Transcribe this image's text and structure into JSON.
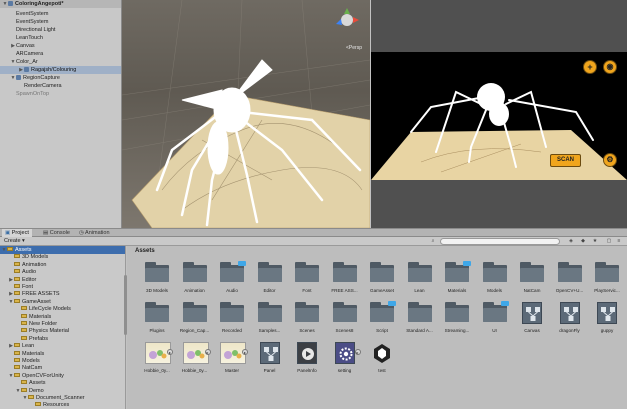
{
  "hierarchy": {
    "rows": [
      {
        "label": "ColoringAngepoti*",
        "indent": 0,
        "arrow": "▼",
        "icon": true,
        "style": "title"
      },
      {
        "label": "EventSystem",
        "indent": 1,
        "arrow": "",
        "icon": false,
        "style": "normal"
      },
      {
        "label": "EventSystem",
        "indent": 1,
        "arrow": "",
        "icon": false,
        "style": "normal"
      },
      {
        "label": "Directional Light",
        "indent": 1,
        "arrow": "",
        "icon": false,
        "style": "normal"
      },
      {
        "label": "LeanTouch",
        "indent": 1,
        "arrow": "",
        "icon": false,
        "style": "normal"
      },
      {
        "label": "Canvas",
        "indent": 1,
        "arrow": "▶",
        "icon": false,
        "style": "normal"
      },
      {
        "label": "ARCamera",
        "indent": 1,
        "arrow": "",
        "icon": false,
        "style": "normal"
      },
      {
        "label": "Color_Ar",
        "indent": 1,
        "arrow": "▼",
        "icon": false,
        "style": "normal"
      },
      {
        "label": "Ragajsh/Colouring",
        "indent": 2,
        "arrow": "▶",
        "icon": true,
        "style": "selected"
      },
      {
        "label": "RegionCapture",
        "indent": 1,
        "arrow": "▼",
        "icon": true,
        "style": "normal"
      },
      {
        "label": "RenderCamera",
        "indent": 2,
        "arrow": "",
        "icon": false,
        "style": "normal"
      },
      {
        "label": "SpawnOnTop",
        "indent": 1,
        "arrow": "",
        "icon": false,
        "style": "dim"
      }
    ]
  },
  "scene": {
    "gizmo_label": "<Persp"
  },
  "game": {
    "scan_label": "SCAN",
    "add_icon": "+",
    "camera_icon": "◉",
    "settings_icon": "⚙"
  },
  "tabs": {
    "project": "Project",
    "console": "Console",
    "animation": "Animation"
  },
  "toolbar": {
    "create_label": "Create ▾"
  },
  "tree": {
    "rows": [
      {
        "label": "Assets",
        "indent": 0,
        "arrow": "▼",
        "selected": true
      },
      {
        "label": "3D Models",
        "indent": 1,
        "arrow": "",
        "selected": false
      },
      {
        "label": "Animation",
        "indent": 1,
        "arrow": "",
        "selected": false
      },
      {
        "label": "Audio",
        "indent": 1,
        "arrow": "",
        "selected": false
      },
      {
        "label": "Editor",
        "indent": 1,
        "arrow": "▶",
        "selected": false
      },
      {
        "label": "Font",
        "indent": 1,
        "arrow": "",
        "selected": false
      },
      {
        "label": "FREE ASSETS",
        "indent": 1,
        "arrow": "▶",
        "selected": false
      },
      {
        "label": "GameAsset",
        "indent": 1,
        "arrow": "▼",
        "selected": false
      },
      {
        "label": "LifeCycle Models",
        "indent": 2,
        "arrow": "",
        "selected": false
      },
      {
        "label": "Materials",
        "indent": 2,
        "arrow": "",
        "selected": false
      },
      {
        "label": "New Folder",
        "indent": 2,
        "arrow": "",
        "selected": false
      },
      {
        "label": "Physics Material",
        "indent": 2,
        "arrow": "",
        "selected": false
      },
      {
        "label": "Prefabs",
        "indent": 2,
        "arrow": "",
        "selected": false
      },
      {
        "label": "Lean",
        "indent": 1,
        "arrow": "▶",
        "selected": false
      },
      {
        "label": "Materials",
        "indent": 1,
        "arrow": "",
        "selected": false
      },
      {
        "label": "Models",
        "indent": 1,
        "arrow": "",
        "selected": false
      },
      {
        "label": "NatCam",
        "indent": 1,
        "arrow": "",
        "selected": false
      },
      {
        "label": "OpenCVForUnity",
        "indent": 1,
        "arrow": "▼",
        "selected": false
      },
      {
        "label": "Assets",
        "indent": 2,
        "arrow": "",
        "selected": false
      },
      {
        "label": "Demo",
        "indent": 2,
        "arrow": "▼",
        "selected": false
      },
      {
        "label": "Document_Scanner",
        "indent": 3,
        "arrow": "▼",
        "selected": false
      },
      {
        "label": "Resources",
        "indent": 4,
        "arrow": "",
        "selected": false
      }
    ]
  },
  "assets": {
    "header": "Assets",
    "items": [
      {
        "label": "3D Models",
        "kind": "folder",
        "badge": false
      },
      {
        "label": "Animation",
        "kind": "folder",
        "badge": false
      },
      {
        "label": "Audio",
        "kind": "folder",
        "badge": true
      },
      {
        "label": "Editor",
        "kind": "folder",
        "badge": false
      },
      {
        "label": "Font",
        "kind": "folder",
        "badge": false
      },
      {
        "label": "FREE ASS...",
        "kind": "folder",
        "badge": false
      },
      {
        "label": "GameAsset",
        "kind": "folder",
        "badge": false
      },
      {
        "label": "Lean",
        "kind": "folder",
        "badge": false
      },
      {
        "label": "Materials",
        "kind": "folder",
        "badge": true
      },
      {
        "label": "Models",
        "kind": "folder",
        "badge": false
      },
      {
        "label": "NatCam",
        "kind": "folder",
        "badge": false
      },
      {
        "label": "OpenCV+U...",
        "kind": "folder",
        "badge": false
      },
      {
        "label": "PlayServic...",
        "kind": "folder",
        "badge": false
      },
      {
        "label": "Plugins",
        "kind": "folder",
        "badge": false
      },
      {
        "label": "Region_Cap...",
        "kind": "folder",
        "badge": false
      },
      {
        "label": "Recorded",
        "kind": "folder",
        "badge": false
      },
      {
        "label": "Samples...",
        "kind": "folder",
        "badge": false
      },
      {
        "label": "Scenes",
        "kind": "folder",
        "badge": false
      },
      {
        "label": "Scenes8",
        "kind": "folder",
        "badge": false
      },
      {
        "label": "Script",
        "kind": "folder",
        "badge": true
      },
      {
        "label": "Standard A...",
        "kind": "folder",
        "badge": false
      },
      {
        "label": "Streaming...",
        "kind": "folder",
        "badge": false
      },
      {
        "label": "UI",
        "kind": "folder",
        "badge": true
      },
      {
        "label": "Canvas",
        "kind": "prefab",
        "badge": false
      },
      {
        "label": "dragonFly",
        "kind": "prefab",
        "badge": false
      },
      {
        "label": "guppy",
        "kind": "prefab",
        "badge": false
      },
      {
        "label": "Hobbie_0y...",
        "kind": "image",
        "badge": false
      },
      {
        "label": "Hobbie_0y...",
        "kind": "image",
        "badge": false
      },
      {
        "label": "Master",
        "kind": "image",
        "badge": false
      },
      {
        "label": "Panel",
        "kind": "prefab",
        "badge": false
      },
      {
        "label": "PanelInfo",
        "kind": "video",
        "badge": false
      },
      {
        "label": "setting",
        "kind": "settings",
        "badge": false
      },
      {
        "label": "test",
        "kind": "unity",
        "badge": false
      }
    ]
  },
  "colors": {
    "accent_orange": "#f0a51d",
    "selection_blue": "#3d6dad",
    "folder_gray": "#5b6770"
  }
}
